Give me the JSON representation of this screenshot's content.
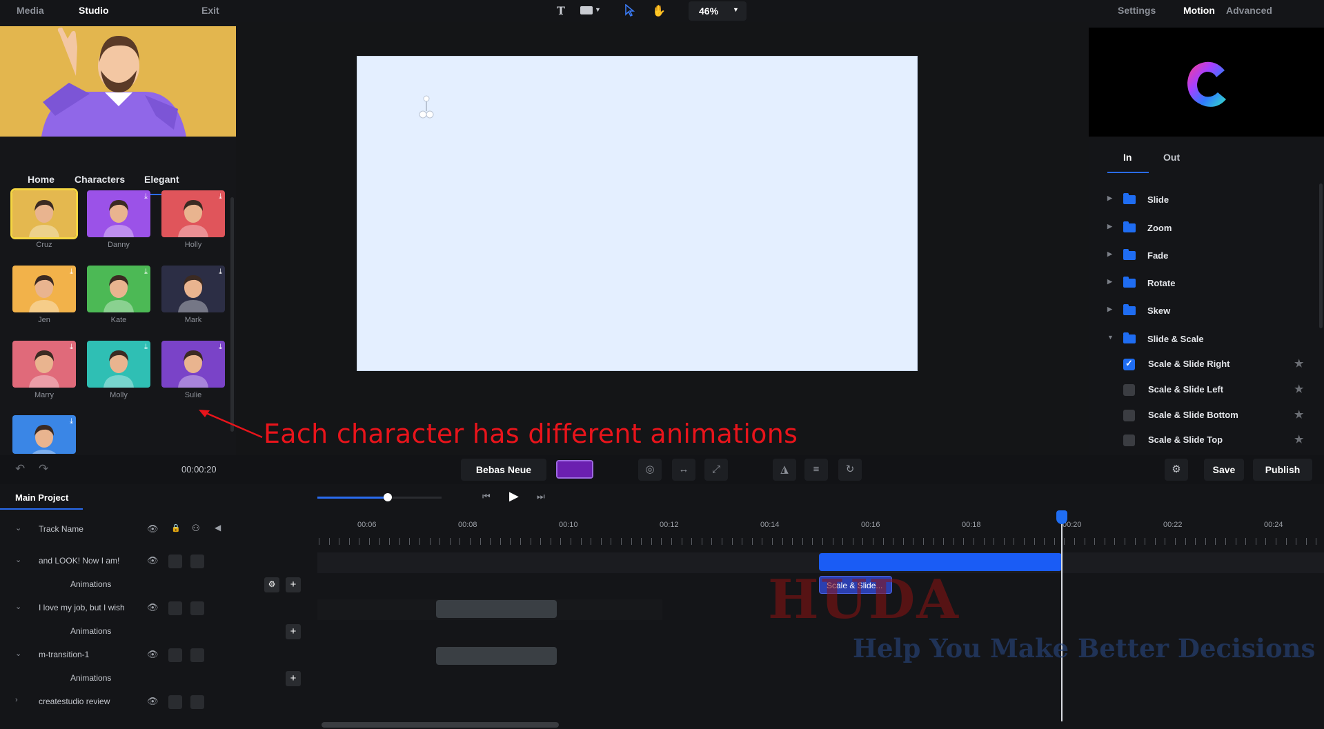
{
  "left_tabs": {
    "media": "Media",
    "studio": "Studio",
    "exit": "Exit"
  },
  "toolbar": {
    "zoom": "46%",
    "zoom_dropdown_icon": "caret-down-icon"
  },
  "right_tabs": {
    "settings": "Settings",
    "motion": "Motion",
    "advanced": "Advanced"
  },
  "char_tabs": {
    "home": "Home",
    "characters": "Characters",
    "elegant": "Elegant"
  },
  "characters": [
    {
      "name": "Cruz",
      "color": "#e4b84f"
    },
    {
      "name": "Danny",
      "color": "#9b52e8"
    },
    {
      "name": "Holly",
      "color": "#e0555b"
    },
    {
      "name": "Jen",
      "color": "#f2b24a"
    },
    {
      "name": "Kate",
      "color": "#4cb955"
    },
    {
      "name": "Mark",
      "color": "#2c2e45"
    },
    {
      "name": "Marry",
      "color": "#e06a7a"
    },
    {
      "name": "Molly",
      "color": "#2fbfb4"
    },
    {
      "name": "Sulie",
      "color": "#7a43c8"
    },
    {
      "name": "",
      "color": "#3a86e6"
    }
  ],
  "annotation": "Each character has different animations",
  "motion": {
    "in_tab": "In",
    "out_tab": "Out",
    "folders": [
      "Slide",
      "Zoom",
      "Fade",
      "Rotate",
      "Skew",
      "Slide & Scale"
    ],
    "animations": [
      {
        "label": "Scale & Slide Right",
        "checked": true
      },
      {
        "label": "Scale & Slide Left",
        "checked": false
      },
      {
        "label": "Scale & Slide Bottom",
        "checked": false
      },
      {
        "label": "Scale & Slide Top",
        "checked": false
      }
    ]
  },
  "midbar": {
    "time": "00:00:20",
    "font": "Bebas Neue",
    "swatch_color": "#6b1fb0",
    "save": "Save",
    "publish": "Publish"
  },
  "timeline": {
    "project_tab": "Main Project",
    "header": "Track Name",
    "ruler_labels": [
      "00:06",
      "00:08",
      "00:10",
      "00:12",
      "00:14",
      "00:16",
      "00:18",
      "00:20",
      "00:22",
      "00:24"
    ],
    "tracks": [
      {
        "name": "and LOOK! Now I am!",
        "sub": "Animations"
      },
      {
        "name": "I love my job, but I wish",
        "sub": "Animations"
      },
      {
        "name": "m-transition-1",
        "sub": "Animations"
      },
      {
        "name": "createstudio review",
        "sub": ""
      }
    ],
    "anim_clip": "Scale & Slide..."
  },
  "watermark": {
    "title": "HUDA",
    "tagline": "Help You Make Better Decisions"
  }
}
